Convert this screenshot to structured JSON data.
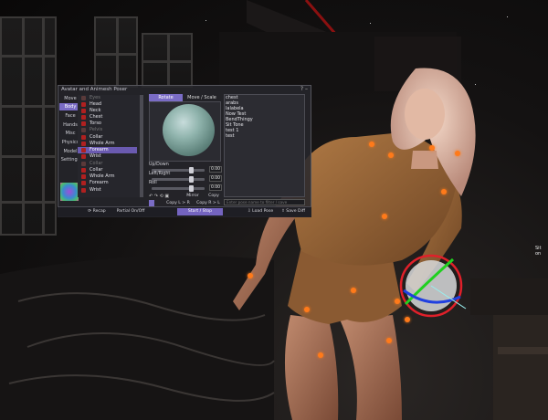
{
  "hud": {
    "title": "Avatar and Animesh Poser",
    "window_controls": "? –",
    "categories": [
      "Move",
      "Body",
      "Face",
      "Hands",
      "Misc",
      "Physics",
      "Model",
      "Settings"
    ],
    "active_category": "Body",
    "joints": [
      {
        "label": "Eyes",
        "state": "dim"
      },
      {
        "label": "Head",
        "state": "normal"
      },
      {
        "label": "Neck",
        "state": "normal"
      },
      {
        "label": "Chest",
        "state": "normal"
      },
      {
        "label": "Torso",
        "state": "normal"
      },
      {
        "label": "Pelvis",
        "state": "dim"
      },
      {
        "label": "Collar",
        "state": "normal"
      },
      {
        "label": "Whole Arm",
        "state": "normal"
      },
      {
        "label": "Forearm",
        "state": "selected"
      },
      {
        "label": "Wrist",
        "state": "normal"
      },
      {
        "label": "Collar",
        "state": "dim"
      },
      {
        "label": "Collar",
        "state": "normal"
      },
      {
        "label": "Whole Arm",
        "state": "normal"
      },
      {
        "label": "Forearm",
        "state": "normal"
      },
      {
        "label": "Wrist",
        "state": "normal"
      }
    ],
    "tabs": [
      "Rotate",
      "Move / Scale"
    ],
    "active_tab": "Rotate",
    "sliders": [
      {
        "label": "Up/Down",
        "value": "0.00",
        "fraction": 0.78
      },
      {
        "label": "Left/Right",
        "value": "0.00",
        "fraction": 0.78
      },
      {
        "label": "Roll",
        "value": "0.00",
        "fraction": 0.78
      }
    ],
    "mirror_label": "Mirror",
    "copy_label": "Copy",
    "copy_row": [
      "Copy L > R",
      "Copy R > L"
    ],
    "bottom_buttons": {
      "recap": "Recap",
      "partial": "Partial On/Off",
      "start_stop": "Start / Stop",
      "load": "Load Pose",
      "save": "Save Diff"
    },
    "pose_list": [
      "chest",
      "arabs",
      "lalabela",
      "Now Test",
      "BendThingy",
      "Sit Tone",
      "test 1",
      "test"
    ],
    "search_placeholder": "Enter pose name to filter / save"
  },
  "world": {
    "edge_text": "Sit on"
  },
  "colors": {
    "accent": "#7a6cc5",
    "joint_marker": "#ff7a1a",
    "gizmo_red": "#e0202a",
    "gizmo_green": "#20d020",
    "gizmo_blue": "#2040e0"
  }
}
